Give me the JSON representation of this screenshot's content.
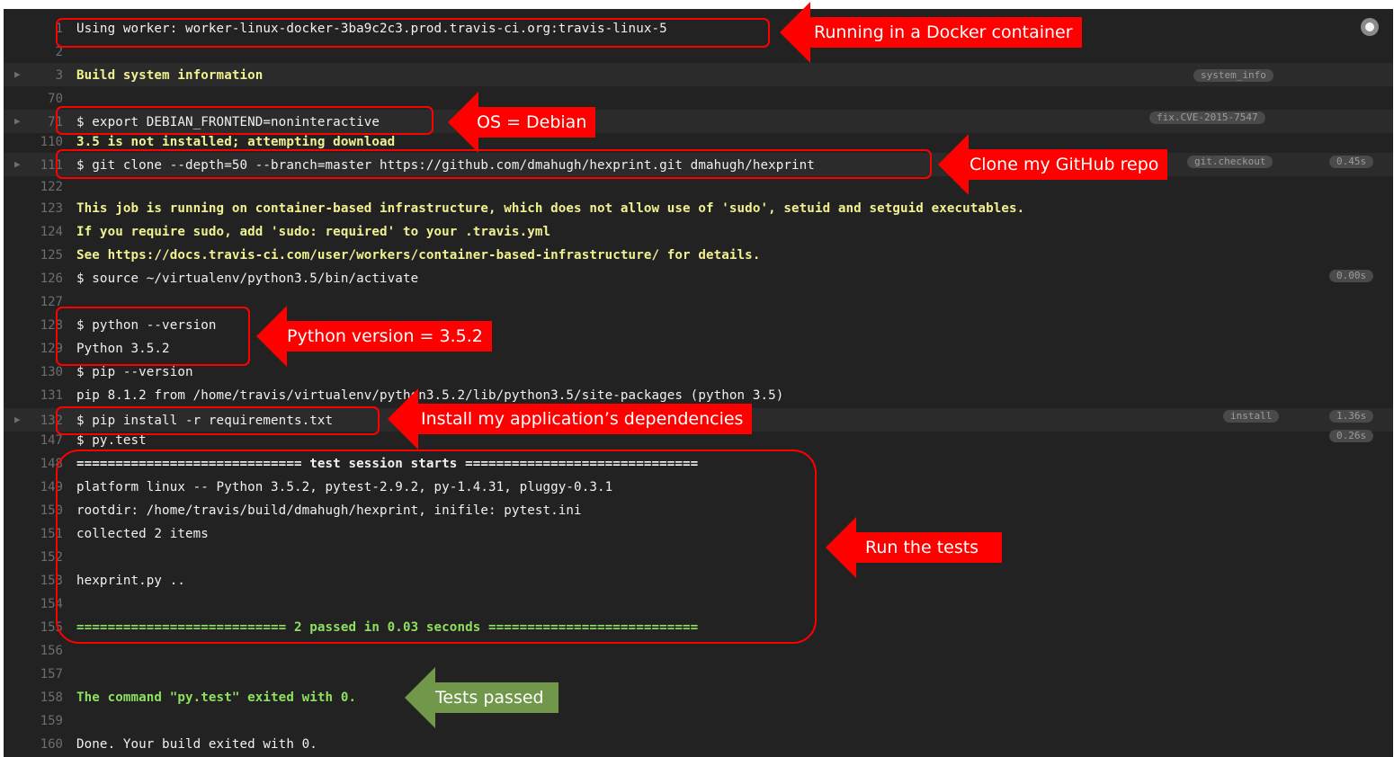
{
  "log_lines": [
    {
      "n": "1",
      "text": "Using worker: worker-linux-docker-3ba9c2c3.prod.travis-ci.org:travis-linux-5",
      "style": "plain"
    },
    {
      "n": "2",
      "text": "",
      "style": "plain"
    },
    {
      "n": "3",
      "text": "Build system information",
      "style": "yellow",
      "fold": true
    },
    {
      "n": "70",
      "text": "",
      "style": "plain"
    },
    {
      "n": "71",
      "text": "$ export DEBIAN_FRONTEND=noninteractive",
      "style": "plain",
      "fold": true
    },
    {
      "n": "110",
      "text": "3.5 is not installed; attempting download",
      "style": "yellow"
    },
    {
      "n": "111",
      "text": "$ git clone --depth=50 --branch=master https://github.com/dmahugh/hexprint.git dmahugh/hexprint",
      "style": "plain",
      "fold": true
    },
    {
      "n": "122",
      "text": "",
      "style": "plain"
    },
    {
      "n": "123",
      "text": "This job is running on container-based infrastructure, which does not allow use of 'sudo', setuid and setguid executables.",
      "style": "yellow"
    },
    {
      "n": "124",
      "text": "If you require sudo, add 'sudo: required' to your .travis.yml",
      "style": "yellow"
    },
    {
      "n": "125",
      "text": "See https://docs.travis-ci.com/user/workers/container-based-infrastructure/ for details.",
      "style": "yellow"
    },
    {
      "n": "126",
      "text": "$ source ~/virtualenv/python3.5/bin/activate",
      "style": "plain"
    },
    {
      "n": "127",
      "text": "",
      "style": "plain"
    },
    {
      "n": "128",
      "text": "$ python --version",
      "style": "plain"
    },
    {
      "n": "129",
      "text": "Python 3.5.2",
      "style": "plain"
    },
    {
      "n": "130",
      "text": "$ pip --version",
      "style": "plain"
    },
    {
      "n": "131",
      "text": "pip 8.1.2 from /home/travis/virtualenv/python3.5.2/lib/python3.5/site-packages (python 3.5)",
      "style": "plain"
    },
    {
      "n": "132",
      "text": "$ pip install -r requirements.txt",
      "style": "plain",
      "fold": true
    },
    {
      "n": "147",
      "text": "$ py.test",
      "style": "plain"
    },
    {
      "n": "148",
      "text": "============================= test session starts ==============================",
      "style": "white-b"
    },
    {
      "n": "149",
      "text": "platform linux -- Python 3.5.2, pytest-2.9.2, py-1.4.31, pluggy-0.3.1",
      "style": "plain"
    },
    {
      "n": "150",
      "text": "rootdir: /home/travis/build/dmahugh/hexprint, inifile: pytest.ini",
      "style": "plain"
    },
    {
      "n": "151",
      "text": "collected 2 items",
      "style": "plain"
    },
    {
      "n": "152",
      "text": "",
      "style": "plain"
    },
    {
      "n": "153",
      "text": "hexprint.py ..",
      "style": "plain"
    },
    {
      "n": "154",
      "text": "",
      "style": "plain"
    },
    {
      "n": "155",
      "text": "=========================== 2 passed in 0.03 seconds ===========================",
      "style": "green"
    },
    {
      "n": "156",
      "text": "",
      "style": "plain"
    },
    {
      "n": "157",
      "text": "",
      "style": "plain"
    },
    {
      "n": "158",
      "text": "The command \"py.test\" exited with 0.",
      "style": "green"
    },
    {
      "n": "159",
      "text": "",
      "style": "plain"
    },
    {
      "n": "160",
      "text": "Done. Your build exited with 0.",
      "style": "plain"
    }
  ],
  "fold_tags": {
    "system_info": "system_info",
    "fix_cve": "fix.CVE-2015-7547",
    "git_checkout": "git.checkout",
    "install": "install"
  },
  "timings": {
    "git_checkout": "0.45s",
    "source": "0.00s",
    "install": "1.36s",
    "pytest": "0.26s"
  },
  "annotations": {
    "docker": "Running in a Docker container",
    "os": "OS = Debian",
    "clone": "Clone my GitHub repo",
    "python": "Python version = 3.5.2",
    "install": "Install my application’s dependencies",
    "tests": "Run the tests",
    "passed": "Tests passed"
  },
  "colors": {
    "terminal_bg": "#222222",
    "yellow_text": "#f2f191",
    "green_text": "#8ee05e",
    "annotation_red": "#ff0000",
    "annotation_green": "#70974a"
  }
}
